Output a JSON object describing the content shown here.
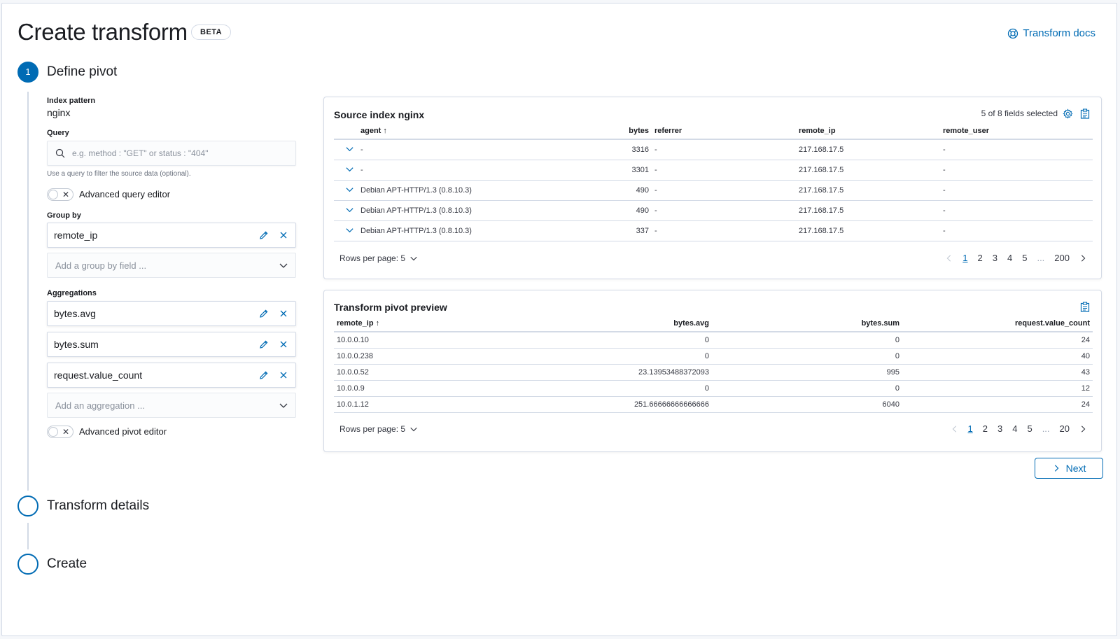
{
  "header": {
    "title": "Create transform",
    "badge": "BETA",
    "docs_link": "Transform docs"
  },
  "steps": [
    {
      "number": "1",
      "title": "Define pivot"
    },
    {
      "number": "",
      "title": "Transform details"
    },
    {
      "number": "",
      "title": "Create"
    }
  ],
  "pivot_form": {
    "index_pattern_label": "Index pattern",
    "index_pattern_value": "nginx",
    "query_label": "Query",
    "query_placeholder": "e.g. method : \"GET\" or status : \"404\"",
    "query_help": "Use a query to filter the source data (optional).",
    "advanced_query_label": "Advanced query editor",
    "group_by_label": "Group by",
    "group_by_items": [
      "remote_ip"
    ],
    "group_by_placeholder": "Add a group by field ...",
    "aggregations_label": "Aggregations",
    "aggregation_items": [
      "bytes.avg",
      "bytes.sum",
      "request.value_count"
    ],
    "aggregation_placeholder": "Add an aggregation ...",
    "advanced_pivot_label": "Advanced pivot editor"
  },
  "source_index": {
    "title": "Source index nginx",
    "fields_selected": "5 of 8 fields selected",
    "columns": [
      "agent",
      "bytes",
      "referrer",
      "remote_ip",
      "remote_user"
    ],
    "rows": [
      [
        "-",
        "3316",
        "-",
        "217.168.17.5",
        "-"
      ],
      [
        "-",
        "3301",
        "-",
        "217.168.17.5",
        "-"
      ],
      [
        "Debian APT-HTTP/1.3 (0.8.10.3)",
        "490",
        "-",
        "217.168.17.5",
        "-"
      ],
      [
        "Debian APT-HTTP/1.3 (0.8.10.3)",
        "490",
        "-",
        "217.168.17.5",
        "-"
      ],
      [
        "Debian APT-HTTP/1.3 (0.8.10.3)",
        "337",
        "-",
        "217.168.17.5",
        "-"
      ]
    ],
    "rows_per_page": "Rows per page: 5",
    "pages": [
      "1",
      "2",
      "3",
      "4",
      "5",
      "...",
      "200"
    ]
  },
  "pivot_preview": {
    "title": "Transform pivot preview",
    "columns": [
      "remote_ip",
      "bytes.avg",
      "bytes.sum",
      "request.value_count"
    ],
    "rows": [
      [
        "10.0.0.10",
        "0",
        "0",
        "24"
      ],
      [
        "10.0.0.238",
        "0",
        "0",
        "40"
      ],
      [
        "10.0.0.52",
        "23.13953488372093",
        "995",
        "43"
      ],
      [
        "10.0.0.9",
        "0",
        "0",
        "12"
      ],
      [
        "10.0.1.12",
        "251.66666666666666",
        "6040",
        "24"
      ]
    ],
    "rows_per_page": "Rows per page: 5",
    "pages": [
      "1",
      "2",
      "3",
      "4",
      "5",
      "...",
      "20"
    ]
  },
  "next_button": "Next",
  "colors": {
    "accent": "#006bb4",
    "border": "#d3dae6",
    "text": "#1a1c21"
  }
}
